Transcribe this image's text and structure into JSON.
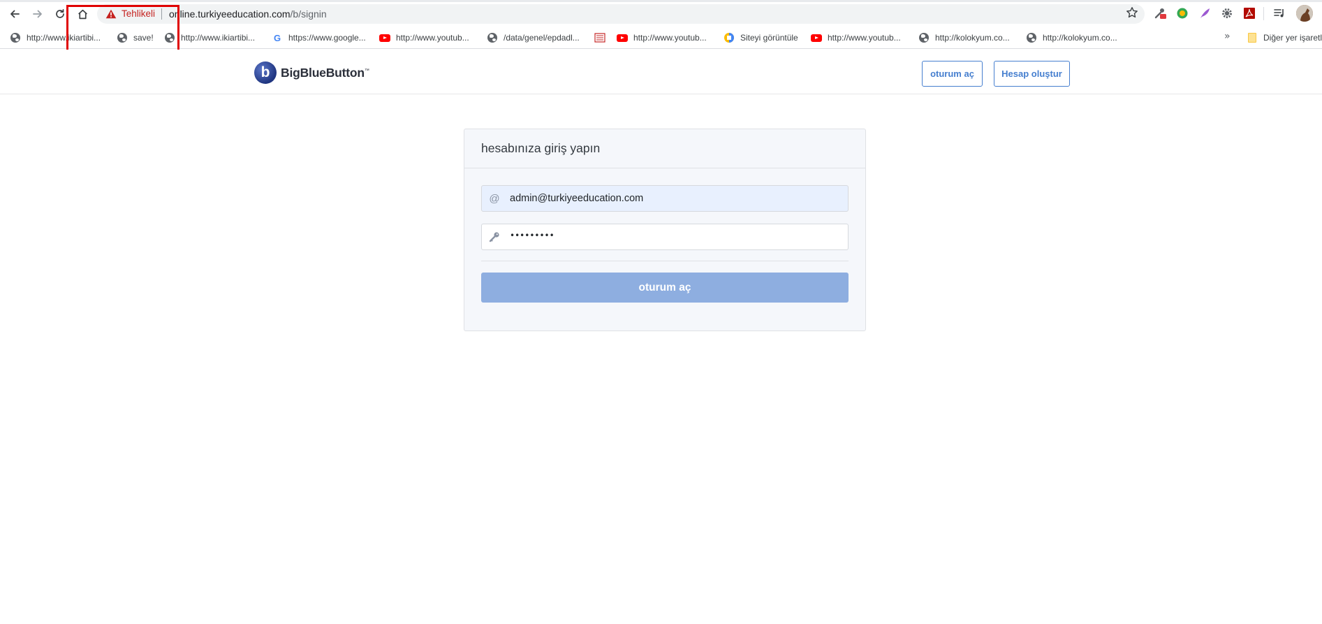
{
  "browser": {
    "security_label": "Tehlikeli",
    "url_host": "online.turkiyeeducation.com",
    "url_path": "/b/signin"
  },
  "bookmarks": [
    {
      "label": "http://www.ikiartibi...",
      "icon": "globe-icon"
    },
    {
      "label": "save!",
      "icon": "globe-icon"
    },
    {
      "label": "http://www.ikiartibi...",
      "icon": "globe-icon"
    },
    {
      "label": "https://www.google...",
      "icon": "google-icon"
    },
    {
      "label": "http://www.youtub...",
      "icon": "youtube-icon"
    },
    {
      "label": "/data/genel/epdadl...",
      "icon": "globe-icon"
    },
    {
      "label": "",
      "icon": "book-icon"
    },
    {
      "label": "http://www.youtub...",
      "icon": "youtube-icon"
    },
    {
      "label": "Siteyi görüntüle",
      "icon": "docs-icon"
    },
    {
      "label": "http://www.youtub...",
      "icon": "youtube-icon"
    },
    {
      "label": "http://kolokyum.co...",
      "icon": "globe-icon"
    },
    {
      "label": "http://kolokyum.co...",
      "icon": "globe-icon"
    }
  ],
  "other_bookmarks": "Diğer yer işaretl",
  "site": {
    "brand": "BigBlueButton",
    "brand_mark": "™",
    "logo_letter": "b",
    "signin_button": "oturum aç",
    "signup_button": "Hesap oluştur"
  },
  "login": {
    "title": "hesabınıza giriş yapın",
    "email_value": "admin@turkiyeeducation.com",
    "email_icon": "@",
    "password_value": "•••••••••",
    "submit_label": "oturum aç"
  },
  "colors": {
    "accent": "#467fcf",
    "submit_disabled": "#8eaee0",
    "danger": "#c5221f",
    "highlight": "#e00000"
  }
}
